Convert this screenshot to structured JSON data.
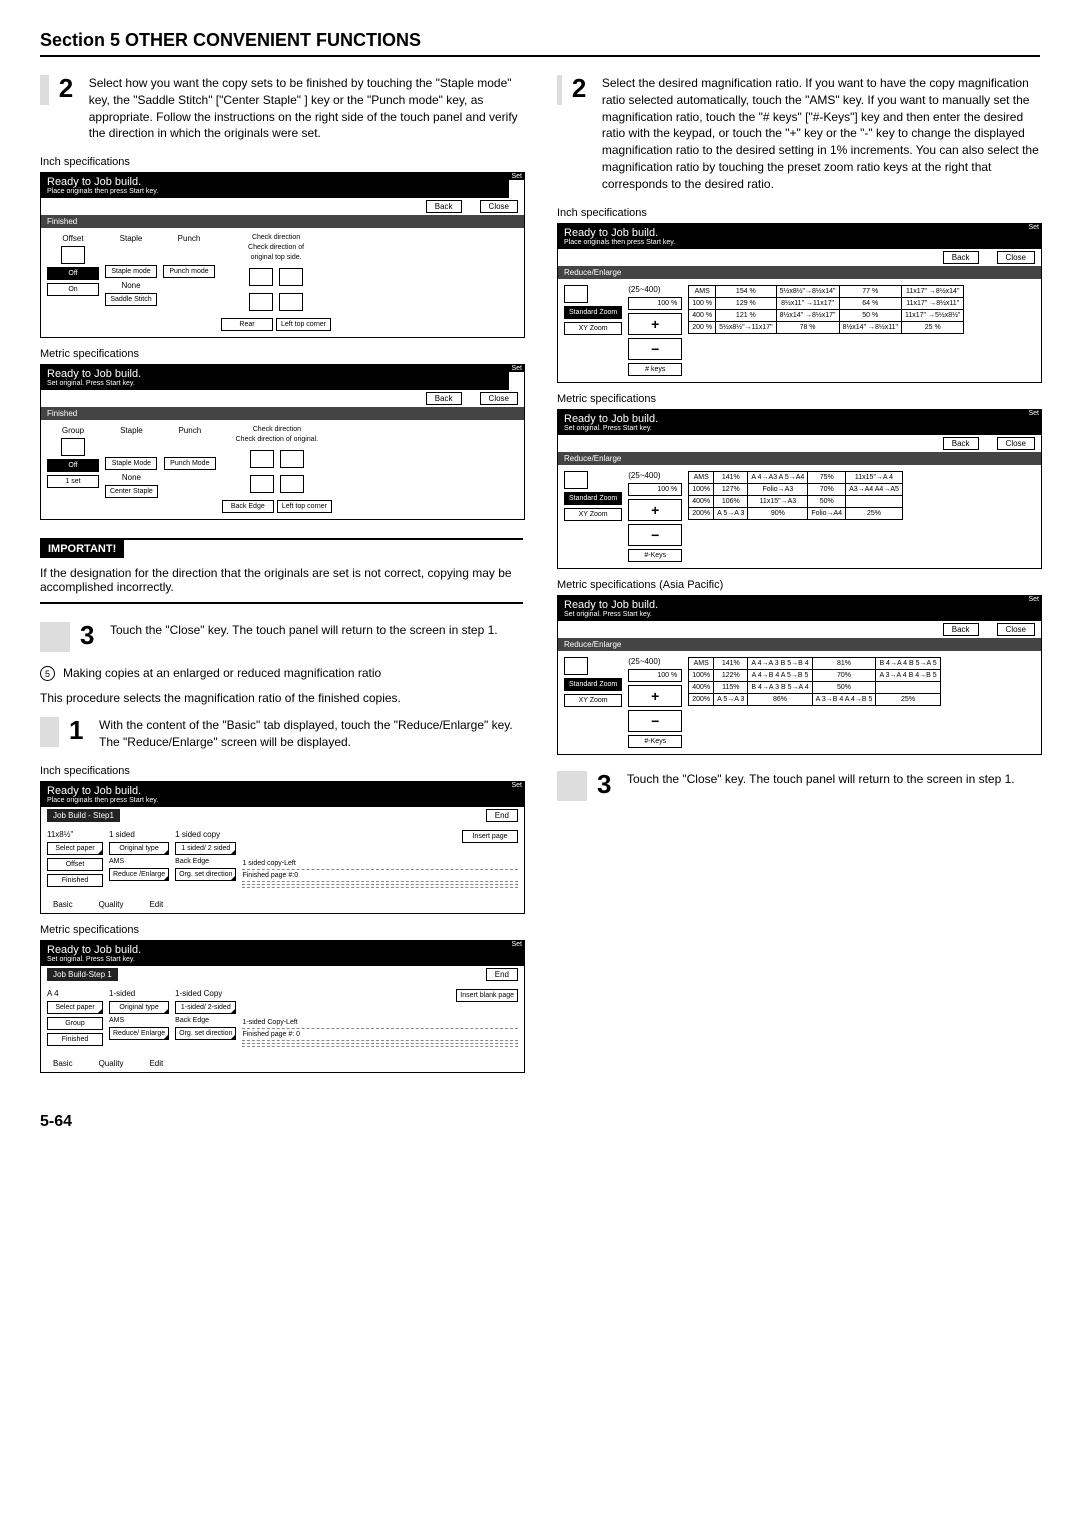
{
  "header": {
    "title": "Section 5  OTHER CONVENIENT FUNCTIONS"
  },
  "left": {
    "step2": {
      "num": "2",
      "text": "Select how you want the copy sets to be finished by touching the \"Staple mode\" key, the \"Saddle Stitch\" [\"Center Staple\" ] key or the \"Punch mode\" key, as appropriate.\nFollow the instructions on the right side of the touch panel and verify the direction in which the originals were set."
    },
    "spec_inch": "Inch specifications",
    "spec_metric": "Metric specifications",
    "panelA": {
      "title": "Ready to Job build.",
      "sub": "Place originals then press Start key.",
      "set": "Set",
      "tab": "Finished",
      "back": "Back",
      "close": "Close",
      "offset": "Offset",
      "staple": "Staple",
      "punch": "Punch",
      "check1": "Check direction",
      "check2": "Check direction of",
      "check3": "original top side.",
      "off": "Off",
      "on": "On",
      "stapleMode": "Staple\nmode",
      "punchMode": "Punch\nmode",
      "none": "None",
      "saddle": "Saddle\nStitch",
      "rear": "Rear",
      "lefttop": "Left top\ncorner"
    },
    "panelB": {
      "title": "Ready to Job build.",
      "sub": "Set original. Press Start key.",
      "set": "Set",
      "tab": "Finished",
      "back": "Back",
      "close": "Close",
      "group": "Group",
      "staple": "Staple",
      "punch": "Punch",
      "check1": "Check direction",
      "check2": "Check direction of original.",
      "off": "Off",
      "oneset": "1 set",
      "stapleMode": "Staple\nMode",
      "punchMode": "Punch\nMode",
      "none": "None",
      "center": "Center\nStaple",
      "backEdge": "Back Edge",
      "lefttop": "Left top\ncorner"
    },
    "important": {
      "title": "IMPORTANT!",
      "text": "If the designation for the direction that the originals are set is not correct, copying may be accomplished incorrectly."
    },
    "step3": {
      "num": "3",
      "text": "Touch the \"Close\" key. The touch panel will return to the screen in step 1."
    },
    "proc5": {
      "num": "5",
      "line1": "Making copies at an enlarged or reduced magnification ratio",
      "line2": "This procedure selects the magnification ratio of the finished copies."
    },
    "step1": {
      "num": "1",
      "text": "With the content of the \"Basic\" tab displayed, touch the \"Reduce/Enlarge\" key. The \"Reduce/Enlarge\" screen will be displayed."
    },
    "basicInch": {
      "title": "Ready to Job build.",
      "sub": "Place originals then press Start key.",
      "set": "Set",
      "step": "Job Build - Step1",
      "end": "End",
      "paper": "11x8½\"",
      "oneSided": "1 sided",
      "oneSidedCopy": "1 sided copy",
      "insert": "Insert\npage",
      "selPaper": "Select\npaper",
      "origType": "Original\ntype",
      "sided12": "1 sided/\n2 sided",
      "ams": "AMS",
      "backEdge": "Back Edge",
      "offset": "Offset",
      "note1": "1 sided copy-Left",
      "note2": "Finished page #:0",
      "finished": "Finished",
      "reduce": "Reduce\n/Enlarge",
      "orgset": "Org. set\ndirection",
      "basic": "Basic",
      "quality": "Quality",
      "edit": "Edit"
    },
    "basicMetric": {
      "title": "Ready to Job build.",
      "sub": "Set original. Press Start key.",
      "set": "Set",
      "step": "Job Build-Step 1",
      "end": "End",
      "paper": "A 4",
      "oneSided": "1-sided",
      "oneSidedCopy": "1-sided Copy",
      "insert": "Insert\nblank page",
      "selPaper": "Select\npaper",
      "origType": "Original\ntype",
      "sided12": "1-sided/\n2-sided",
      "ams": "AMS",
      "backEdge": "Back Edge",
      "group": "Group",
      "note1": "1-sided Copy-Left",
      "note2": "Finished page #: 0",
      "finished": "Finished",
      "reduce": "Reduce/\nEnlarge",
      "orgset": "Org. set\ndirection",
      "basic": "Basic",
      "quality": "Quality",
      "edit": "Edit"
    }
  },
  "right": {
    "step2": {
      "num": "2",
      "text": "Select the desired magnification ratio.\nIf you want to have the copy magnification ratio selected automatically, touch the \"AMS\" key.\nIf you want to manually set the magnification ratio, touch the \"# keys\" [\"#-Keys\"] key and then enter the desired ratio with the keypad, or touch the \"+\" key or the \"-\" key to change the displayed magnification ratio to the desired setting in 1% increments.\nYou can also select the magnification ratio by touching the preset zoom ratio keys at the right that corresponds to the desired ratio."
    },
    "spec_inch": "Inch specifications",
    "spec_metric": "Metric specifications",
    "spec_asia": "Metric specifications (Asia Pacific)",
    "reInch": {
      "title": "Ready to Job build.",
      "sub": "Place originals then press Start key.",
      "set": "Set",
      "tab": "Reduce/Enlarge",
      "back": "Back",
      "close": "Close",
      "range": "(25~400)",
      "hundred": "100",
      "pct": "%",
      "std": "Standard\nZoom",
      "xy": "XY Zoom",
      "hash": "# keys",
      "rows": [
        [
          "AMS",
          "154 %",
          "5½x8½\"→8½x14\"",
          "77 %",
          "11x17\" →8½x14\""
        ],
        [
          "100 %",
          "129 %",
          "8½x11\" →11x17\"",
          "64 %",
          "11x17\" →8½x11\""
        ],
        [
          "400 %",
          "121 %",
          "8½x14\" →8½x17\"",
          "50 %",
          "11x17\" →5½x8½\""
        ],
        [
          "200 %",
          "5½x8½\"→11x17\"",
          "78 %",
          "8½x14\" →8½x11\"",
          "25 %"
        ]
      ]
    },
    "reMetric": {
      "title": "Ready to Job build.",
      "sub": "Set original. Press Start key.",
      "set": "Set",
      "tab": "Reduce/Enlarge",
      "back": "Back",
      "close": "Close",
      "range": "(25~400)",
      "hundred": "100",
      "pct": "%",
      "std": "Standard\nZoom",
      "xy": "XY Zoom",
      "hash": "#-Keys",
      "rows": [
        [
          "AMS",
          "141%",
          "A 4→A3  A 5→A4",
          "75%",
          "11x15\"→A 4"
        ],
        [
          "100%",
          "127%",
          "Folio→A3",
          "70%",
          "A3→A4  A4→A5"
        ],
        [
          "400%",
          "106%",
          "11x15\"→A3",
          "50%",
          ""
        ],
        [
          "200%",
          "A 5→A 3",
          "90%",
          "Folio→A4",
          "25%"
        ]
      ]
    },
    "reAsia": {
      "title": "Ready to Job build.",
      "sub": "Set original. Press Start key.",
      "set": "Set",
      "tab": "Reduce/Enlarge",
      "back": "Back",
      "close": "Close",
      "range": "(25~400)",
      "hundred": "100",
      "pct": "%",
      "std": "Standard\nZoom",
      "xy": "XY Zoom",
      "hash": "#-Keys",
      "rows": [
        [
          "AMS",
          "141%",
          "A 4→A 3  B 5→B 4",
          "81%",
          "B 4→A 4  B 5→A 5"
        ],
        [
          "100%",
          "122%",
          "A 4→B 4  A 5→B 5",
          "70%",
          "A 3→A 4  B 4→B 5"
        ],
        [
          "400%",
          "115%",
          "B 4→A 3  B 5→A 4",
          "50%",
          ""
        ],
        [
          "200%",
          "A 5→A 3",
          "86%",
          "A 3→B 4  A 4→B 5",
          "25%"
        ]
      ]
    },
    "step3": {
      "num": "3",
      "text": "Touch the \"Close\" key. The touch panel will return to the screen in step 1."
    }
  },
  "footer": {
    "page": "5-64"
  }
}
